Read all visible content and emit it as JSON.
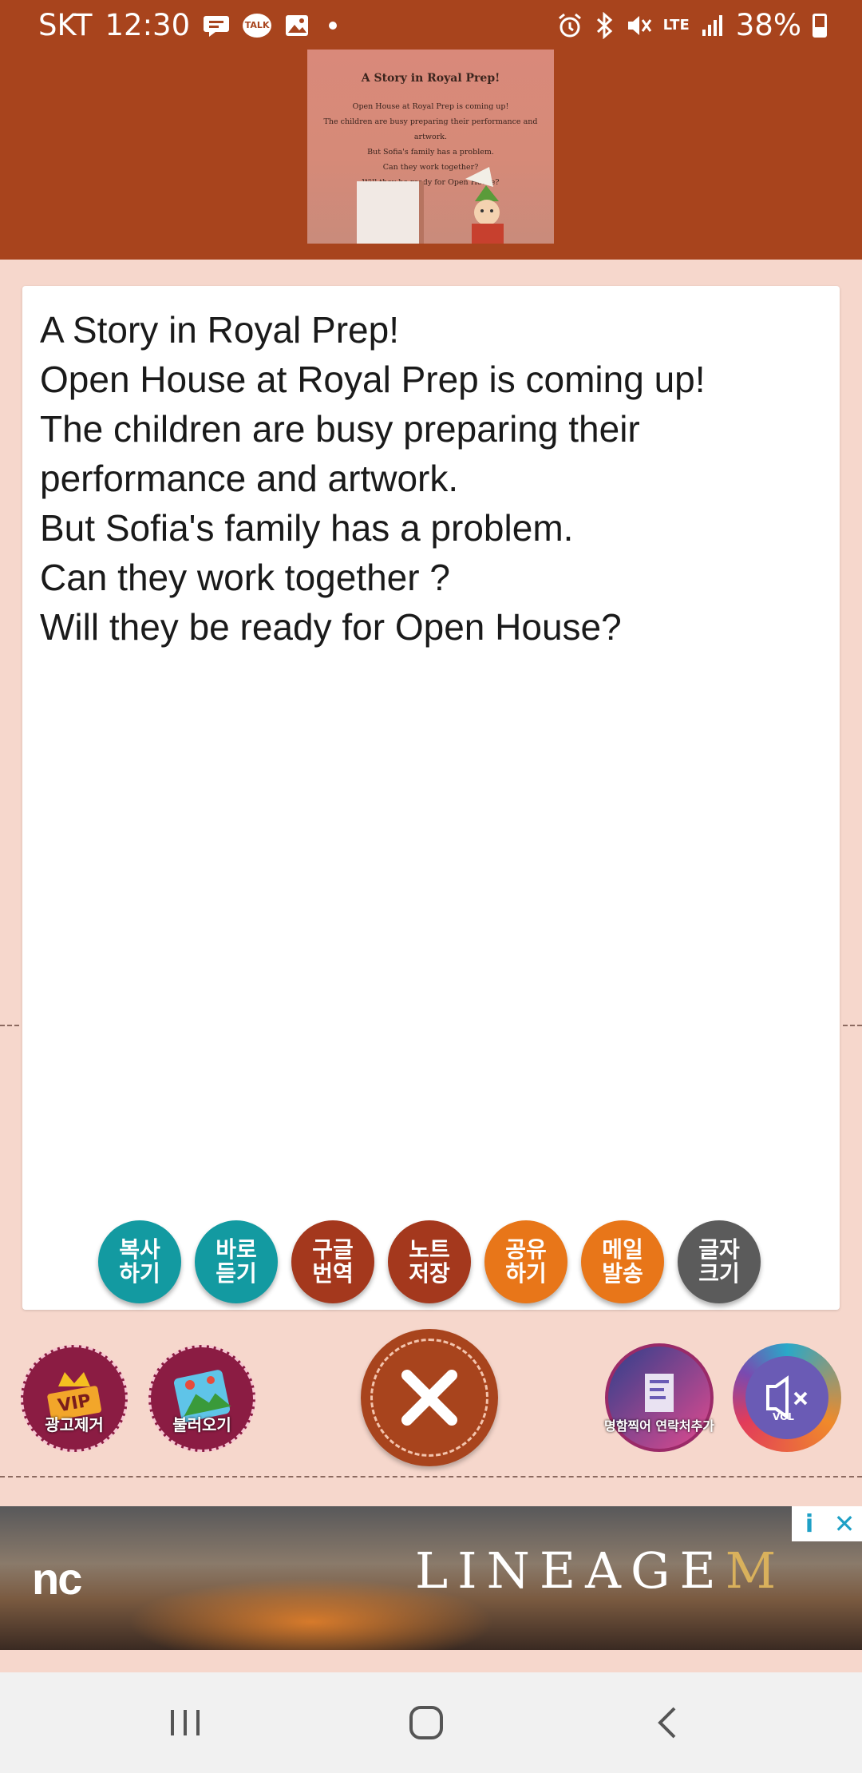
{
  "status_bar": {
    "carrier": "SKT",
    "time": "12:30",
    "talk_label": "TALK",
    "network": "LTE",
    "battery": "38%",
    "icons": [
      "chat-icon",
      "talk-icon",
      "image-icon",
      "dot-icon",
      "alarm-icon",
      "bluetooth-icon",
      "mute-icon",
      "lte-icon",
      "signal-icon",
      "battery-icon"
    ]
  },
  "thumbnail": {
    "title": "A Story in Royal Prep!",
    "lines": [
      "Open House at Royal Prep is coming up!",
      "The children are busy preparing their performance and artwork.",
      "But Sofia's family has a problem.",
      "Can they work together?",
      "Will they be ready for Open House?"
    ]
  },
  "story": {
    "lines": [
      "A Story in Royal Prep!",
      "Open House at Royal Prep is coming up!",
      "The children are busy preparing their",
      "performance and artwork.",
      "But Sofia's family has a problem.",
      "Can they work together ?",
      "Will they be ready for Open House?"
    ]
  },
  "actions": [
    {
      "line1": "복사",
      "line2": "하기",
      "color": "#139aa1"
    },
    {
      "line1": "바로",
      "line2": "듣기",
      "color": "#139aa1"
    },
    {
      "line1": "구글",
      "line2": "번역",
      "color": "#a4381d"
    },
    {
      "line1": "노트",
      "line2": "저장",
      "color": "#a4381d"
    },
    {
      "line1": "공유",
      "line2": "하기",
      "color": "#e87619"
    },
    {
      "line1": "메일",
      "line2": "발송",
      "color": "#e87619"
    },
    {
      "line1": "글자",
      "line2": "크기",
      "color": "#5b5b5b"
    }
  ],
  "tools": {
    "vip_badge": "VIP",
    "vip_label": "광고제거",
    "load_label": "불러오기",
    "card_label": "명함찍어 연락처추가",
    "vol_label": "VOL"
  },
  "ad": {
    "brand": "nc",
    "title_main": "LINEAGE",
    "title_m": "M",
    "info": "i",
    "close": "✕"
  },
  "colors": {
    "header": "#a8441d",
    "background": "#f6d7cc",
    "teal": "#139aa1",
    "brick": "#a4381d",
    "orange": "#e87619",
    "gray": "#5b5b5b"
  }
}
